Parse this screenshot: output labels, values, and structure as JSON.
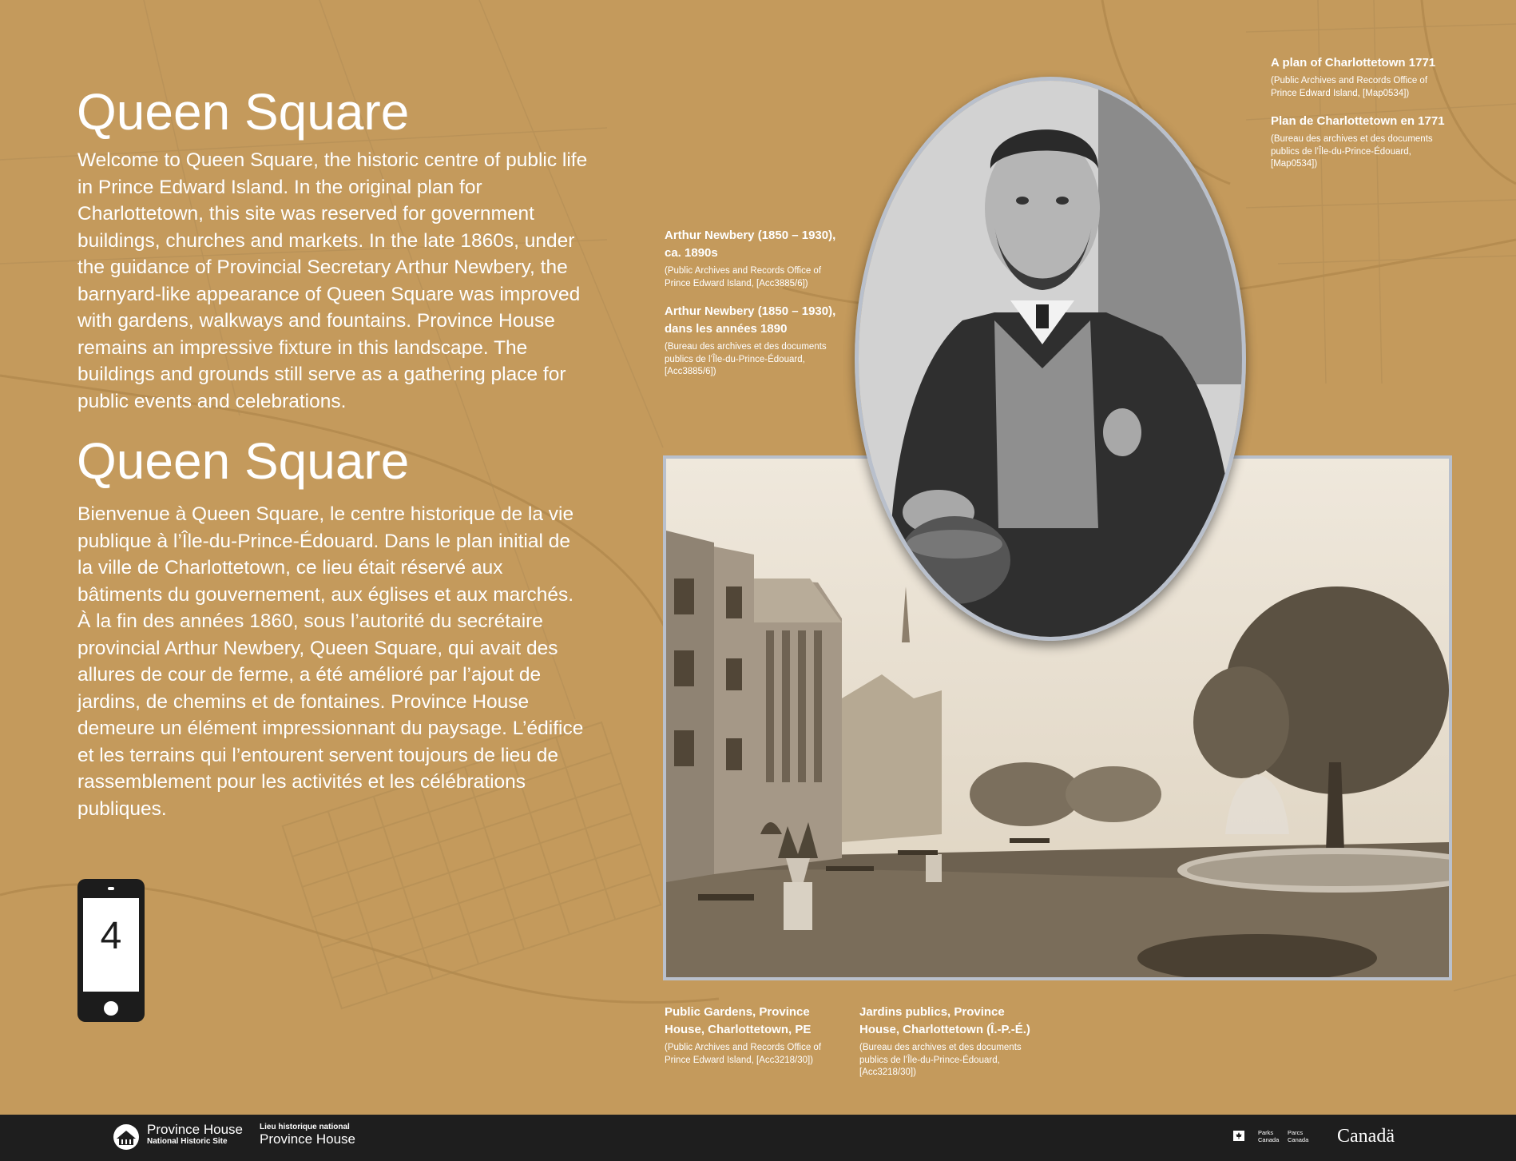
{
  "panel": {
    "title_en": "Queen Square",
    "body_en": "Welcome to Queen Square, the historic centre of public life in Prince Edward Island.  In the original plan for Charlottetown, this site was reserved for government buildings, churches and markets. In the late 1860s, under the guidance of Provincial Secretary Arthur Newbery, the barnyard-like appearance of Queen Square was improved with gardens, walkways and fountains. Province House remains an impressive fixture in this landscape. The buildings and grounds still serve as a gathering place for public events and celebrations.",
    "title_fr": "Queen Square",
    "body_fr": "Bienvenue à Queen Square, le centre historique de la vie publique à l’Île-du-Prince-Édouard. Dans le plan initial de la ville de Charlottetown, ce lieu était réservé aux bâtiments du gouvernement, aux églises et aux marchés. À la fin des années 1860, sous l’autorité du secrétaire provincial Arthur Newbery, Queen Square, qui avait des allures de cour de ferme, a été amélioré par l’ajout de jardins, de chemins et de fontaines. Province House demeure un élément impressionnant du paysage. L’édifice et les terrains qui l’entourent servent toujours de lieu de rassemblement pour les activités et les célébrations publiques.",
    "stop_number": "4"
  },
  "captions": {
    "map_en_title": "A plan of Charlottetown 1771",
    "map_en_source": "(Public Archives and Records Office of Prince Edward Island, [Map0534])",
    "map_fr_title": "Plan de Charlottetown en 1771",
    "map_fr_source": "(Bureau des archives et des documents publics de l’Île-du-Prince-Édouard, [Map0534])",
    "portrait_en_title": "Arthur Newbery (1850 – 1930), ca. 1890s",
    "portrait_en_source": "(Public Archives and Records Office of Prince Edward Island, [Acc3885/6])",
    "portrait_fr_title": "Arthur Newbery (1850 – 1930), dans les années 1890",
    "portrait_fr_source": "(Bureau des archives et des documents publics de l’Île-du-Prince-Édouard, [Acc3885/6])",
    "gardens_en_title": "Public Gardens, Province House, Charlottetown, PE",
    "gardens_en_source": "(Public Archives and Records Office of Prince Edward Island, [Acc3218/30])",
    "gardens_fr_title": "Jardins publics, Province House, Charlottetown (Î.-P.-É.)",
    "gardens_fr_source": "(Bureau des archives et des documents publics de l’Île-du-Prince-Édouard, [Acc3218/30])"
  },
  "footer": {
    "site_name_en": "Province House",
    "site_type_en": "National Historic Site",
    "site_type_fr": "Lieu historique national",
    "site_name_fr": "Province House",
    "parks_en": "Parks Canada",
    "parks_fr": "Parcs Canada",
    "wordmark": "Canadä"
  },
  "colors": {
    "background": "#c49a5c",
    "frame": "#b9c0cc",
    "footer": "#1e1e1e"
  },
  "icons": [
    "smartphone-icon",
    "province-house-logo-icon",
    "canada-flag-icon"
  ]
}
